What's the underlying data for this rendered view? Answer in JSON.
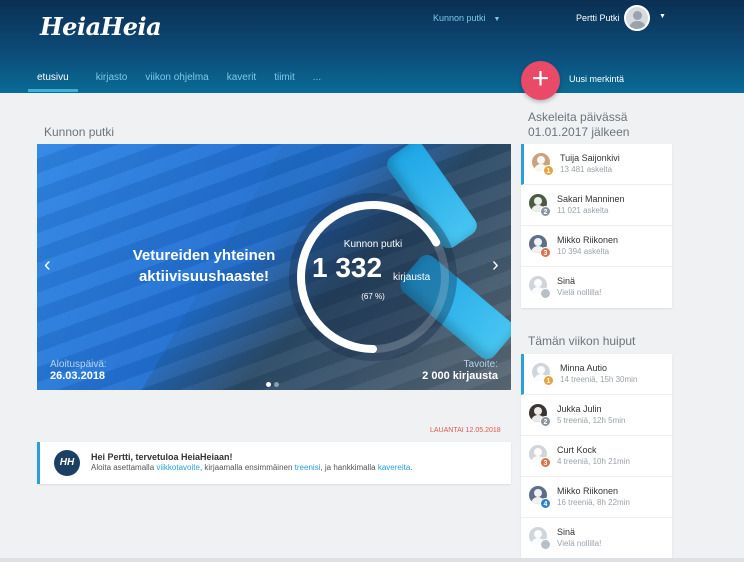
{
  "header": {
    "logo": "HeiaHeia",
    "team_select": "Kunnon putki",
    "user_name": "Pertti Putki",
    "new_entry": "Uusi merkintä",
    "nav": [
      {
        "label": "etusivu",
        "active": true
      },
      {
        "label": "kirjasto"
      },
      {
        "label": "viikon ohjelma"
      },
      {
        "label": "kaverit"
      },
      {
        "label": "tiimit"
      },
      {
        "label": "..."
      }
    ]
  },
  "main": {
    "section_title": "Kunnon putki",
    "hero": {
      "headline_line1": "Vetureiden yhteinen",
      "headline_line2": "aktiivisuushaaste!",
      "ring_title": "Kunnon putki",
      "count": "1 332",
      "unit": "kirjausta",
      "percent_label": "(67 %)",
      "progress": 0.67,
      "start_label": "Aloituspäivä:",
      "start_date": "26.03.2018",
      "goal_label": "Tavoite:",
      "goal_value": "2 000 kirjausta"
    },
    "date_stamp": "LAUANTAI 12.05.2018",
    "welcome": {
      "logo_text": "HH",
      "title": "Hei Pertti, tervetuloa HeiaHeiaan!",
      "text_1": "Aloita asettamalla ",
      "link_1": "viikkotavoite",
      "text_2": ", kirjaamalla ensimmäinen ",
      "link_2": "treenisi",
      "text_3": ", ja hankkimalla ",
      "link_3": "kavereita",
      "text_4": "."
    }
  },
  "steps": {
    "title_line1": "Askeleita päivässä",
    "title_line2": "01.01.2017 jälkeen",
    "items": [
      {
        "rank": "1",
        "name": "Tuija Saijonkivi",
        "value": "13 481 askelta"
      },
      {
        "rank": "2",
        "name": "Sakari Manninen",
        "value": "11 021 askelta"
      },
      {
        "rank": "3",
        "name": "Mikko Riikonen",
        "value": "10 394 askelta"
      },
      {
        "rank": "",
        "name": "Sinä",
        "value": "Vielä nollilla!"
      }
    ]
  },
  "weekly": {
    "title": "Tämän viikon huiput",
    "items": [
      {
        "rank": "1",
        "name": "Minna Autio",
        "value": "14 treeniä, 15h 30min"
      },
      {
        "rank": "2",
        "name": "Jukka Julin",
        "value": "5 treeniä, 12h 5min"
      },
      {
        "rank": "3",
        "name": "Curt Kock",
        "value": "4 treeniä, 10h 21min"
      },
      {
        "rank": "4",
        "name": "Mikko Riikonen",
        "value": "16 treeniä, 8h 22min"
      },
      {
        "rank": "",
        "name": "Sinä",
        "value": "Vielä nollilla!"
      }
    ]
  }
}
